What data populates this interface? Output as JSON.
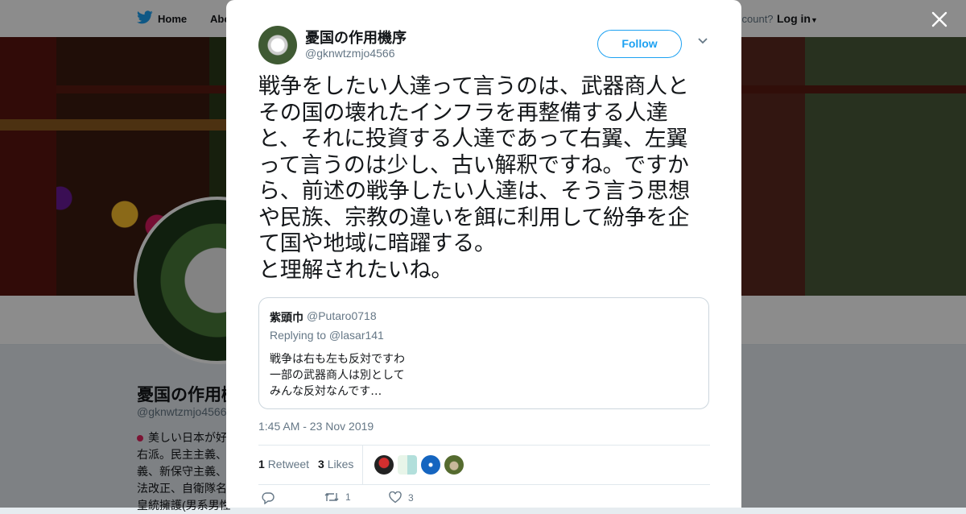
{
  "topnav": {
    "home_label": "Home",
    "about_label": "Abo",
    "account_label": "ccount?",
    "login_label": "Log in"
  },
  "profile": {
    "name": "憂国の作用機",
    "handle": "@gknwtzmjo4566",
    "bio": "美しい日本が好\n右派。民主主義、\n義、新保守主義、\n法改正、自衛隊名\n皇統擁護(男系男性"
  },
  "tweet": {
    "author_name": "憂国の作用機序",
    "author_handle": "@gknwtzmjo4566",
    "follow_label": "Follow",
    "text": "戦争をしたい人達って言うのは、武器商人と\nその国の壊れたインフラを再整備する人達\nと、それに投資する人達であって右翼、左翼\nって言うのは少し、古い解釈ですね。ですか\nら、前述の戦争したい人達は、そう言う思想\nや民族、宗教の違いを餌に利用して紛争を企\nて国や地域に暗躍する。\nと理解されたいね。",
    "timestamp": "1:45 AM - 23 Nov 2019",
    "quoted": {
      "name": "紫頭巾",
      "handle": "@Putaro0718",
      "replying_to": "Replying to @lasar141",
      "text": "戦争は右も左も反対ですわ\n一部の武器商人は別として\nみんな反対なんです…"
    },
    "stats": {
      "retweets_count": "1",
      "retweets_label": "Retweet",
      "likes_count": "3",
      "likes_label": "Likes"
    },
    "actions": {
      "retweet_count": "1",
      "like_count": "3"
    }
  },
  "colors": {
    "accent": "#1da1f2",
    "text": "#14171a",
    "muted": "#657786"
  },
  "icons": [
    "twitter-bird-icon",
    "close-icon",
    "chevron-down-icon",
    "reply-icon",
    "retweet-icon",
    "heart-icon"
  ]
}
